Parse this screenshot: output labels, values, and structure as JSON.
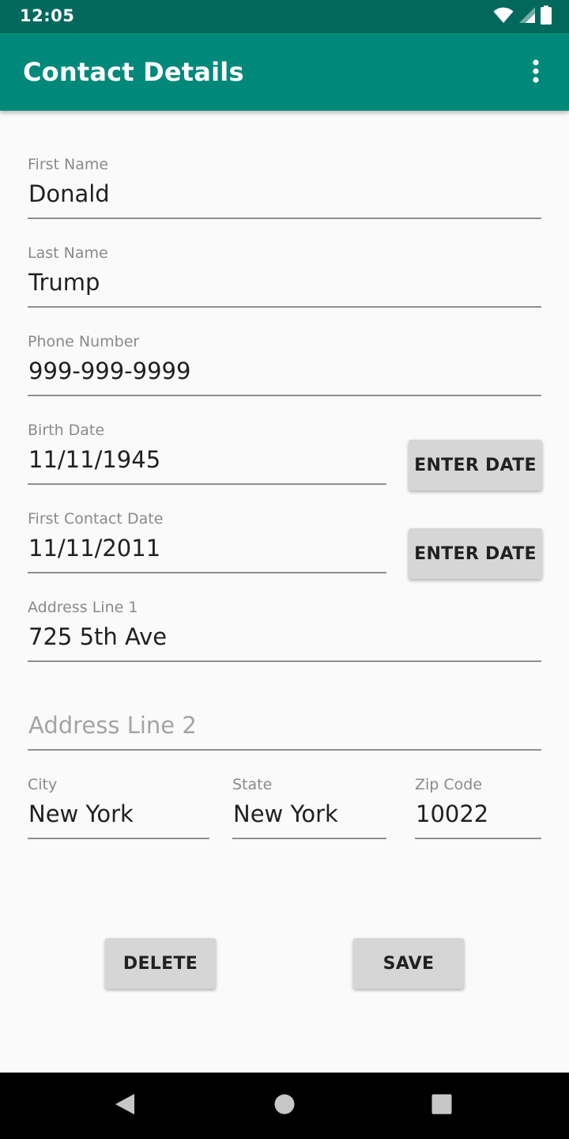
{
  "status_bar": {
    "time": "12:05",
    "icons": [
      "wifi-icon",
      "signal-icon",
      "battery-icon"
    ]
  },
  "app_bar": {
    "title": "Contact Details",
    "menu_icon": "more-vertical-icon"
  },
  "form": {
    "first_name": {
      "label": "First Name",
      "value": "Donald"
    },
    "last_name": {
      "label": "Last Name",
      "value": "Trump"
    },
    "phone": {
      "label": "Phone Number",
      "value": "999-999-9999"
    },
    "birth_date": {
      "label": "Birth Date",
      "value": "11/11/1945",
      "button": "ENTER DATE"
    },
    "first_contact_date": {
      "label": "First Contact Date",
      "value": "11/11/2011",
      "button": "ENTER DATE"
    },
    "address1": {
      "label": "Address Line 1",
      "value": "725 5th Ave"
    },
    "address2": {
      "placeholder": "Address Line 2",
      "value": ""
    },
    "city": {
      "label": "City",
      "value": "New York"
    },
    "state": {
      "label": "State",
      "value": "New York"
    },
    "zip": {
      "label": "Zip Code",
      "value": "10022"
    }
  },
  "actions": {
    "delete": "DELETE",
    "save": "SAVE"
  },
  "nav_bar": {
    "icons": [
      "back-icon",
      "home-icon",
      "recents-icon"
    ]
  },
  "colors": {
    "status_bar": "#00695c",
    "app_bar": "#00897b",
    "background": "#fafafa",
    "button": "#d6d6d6"
  }
}
